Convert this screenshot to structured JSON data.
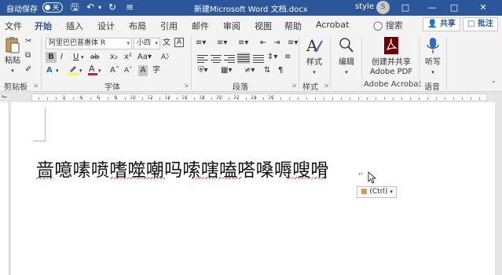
{
  "title_bar": {
    "autosave_label": "自动保存",
    "autosave_state": "关",
    "document_title": "新建Microsoft Word 文档.docx",
    "user_name": "style",
    "avatar_initial": "S"
  },
  "tabs": [
    "文件",
    "开始",
    "插入",
    "设计",
    "布局",
    "引用",
    "邮件",
    "审阅",
    "视图",
    "帮助",
    "Acrobat"
  ],
  "active_tab": "开始",
  "tell_me": "搜索",
  "share_label": "共享",
  "comment_label": "批注",
  "ribbon": {
    "clipboard": {
      "paste_label": "粘贴",
      "group_label": "剪贴板"
    },
    "font": {
      "font_name": "阿里巴巴普惠体 R",
      "font_size": "小四",
      "group_label": "字体"
    },
    "paragraph": {
      "group_label": "段落"
    },
    "styles": {
      "button_label": "样式",
      "group_label": "样式"
    },
    "editing": {
      "button_label": "编辑"
    },
    "adobe": {
      "button_label_line1": "创建并共享",
      "button_label_line2": "Adobe PDF",
      "group_label": "Adobe Acrobat"
    },
    "voice": {
      "button_label": "听写",
      "group_label": "语音"
    }
  },
  "ruler_numbers": [
    "2",
    "4",
    "6",
    "8",
    "10",
    "12",
    "14",
    "16",
    "18",
    "20",
    "22",
    "24",
    "26"
  ],
  "document": {
    "body_text": "啬噫嗉喷嗜噬嘲吗嗦嗐嗑嗒嗓嗕嗖嗗",
    "paste_options_label": "(Ctrl)"
  },
  "colors": {
    "accent": "#2b579a",
    "highlight": "#ffff00",
    "font_color": "#e81123"
  }
}
